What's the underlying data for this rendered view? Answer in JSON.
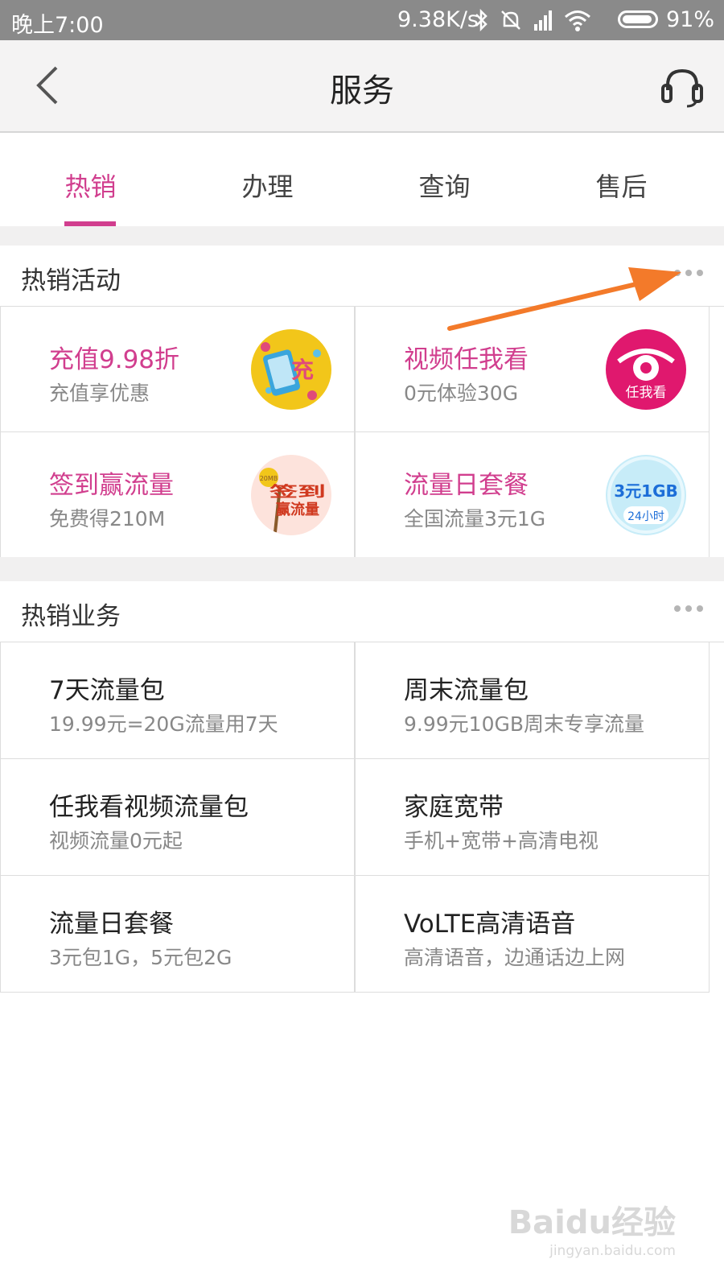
{
  "status_bar": {
    "time": "晚上7:00",
    "speed": "9.38K/s",
    "battery": "91%"
  },
  "header": {
    "title": "服务",
    "back_icon": "chevron-left-icon",
    "support_icon": "headset-icon"
  },
  "tabs": [
    {
      "label": "热销",
      "active": true
    },
    {
      "label": "办理",
      "active": false
    },
    {
      "label": "查询",
      "active": false
    },
    {
      "label": "售后",
      "active": false
    }
  ],
  "hot_activities": {
    "title": "热销活动",
    "items": [
      {
        "title": "充值9.98折",
        "subtitle": "充值享优惠",
        "badge_text": "充"
      },
      {
        "title": "视频任我看",
        "subtitle": "0元体验30G",
        "badge_text": "任我看"
      },
      {
        "title": "签到赢流量",
        "subtitle": "免费得210M",
        "badge_text": "签到赢流量",
        "badge_small": "20MB"
      },
      {
        "title": "流量日套餐",
        "subtitle": "全国流量3元1G",
        "badge_text": "3元1GB",
        "badge_small": "24小时"
      }
    ]
  },
  "hot_business": {
    "title": "热销业务",
    "items": [
      {
        "title": "7天流量包",
        "subtitle": "19.99元=20G流量用7天"
      },
      {
        "title": "周末流量包",
        "subtitle": "9.99元10GB周末专享流量"
      },
      {
        "title": "任我看视频流量包",
        "subtitle": "视频流量0元起"
      },
      {
        "title": "家庭宽带",
        "subtitle": "手机+宽带+高清电视"
      },
      {
        "title": "流量日套餐",
        "subtitle": "3元包1G，5元包2G"
      },
      {
        "title": "VoLTE高清语音",
        "subtitle": "高清语音，边通话边上网"
      }
    ]
  },
  "watermark": {
    "brand": "Baidu经验",
    "url": "jingyan.baidu.com"
  },
  "colors": {
    "accent": "#d13e8e",
    "arrow": "#f37a2a"
  }
}
